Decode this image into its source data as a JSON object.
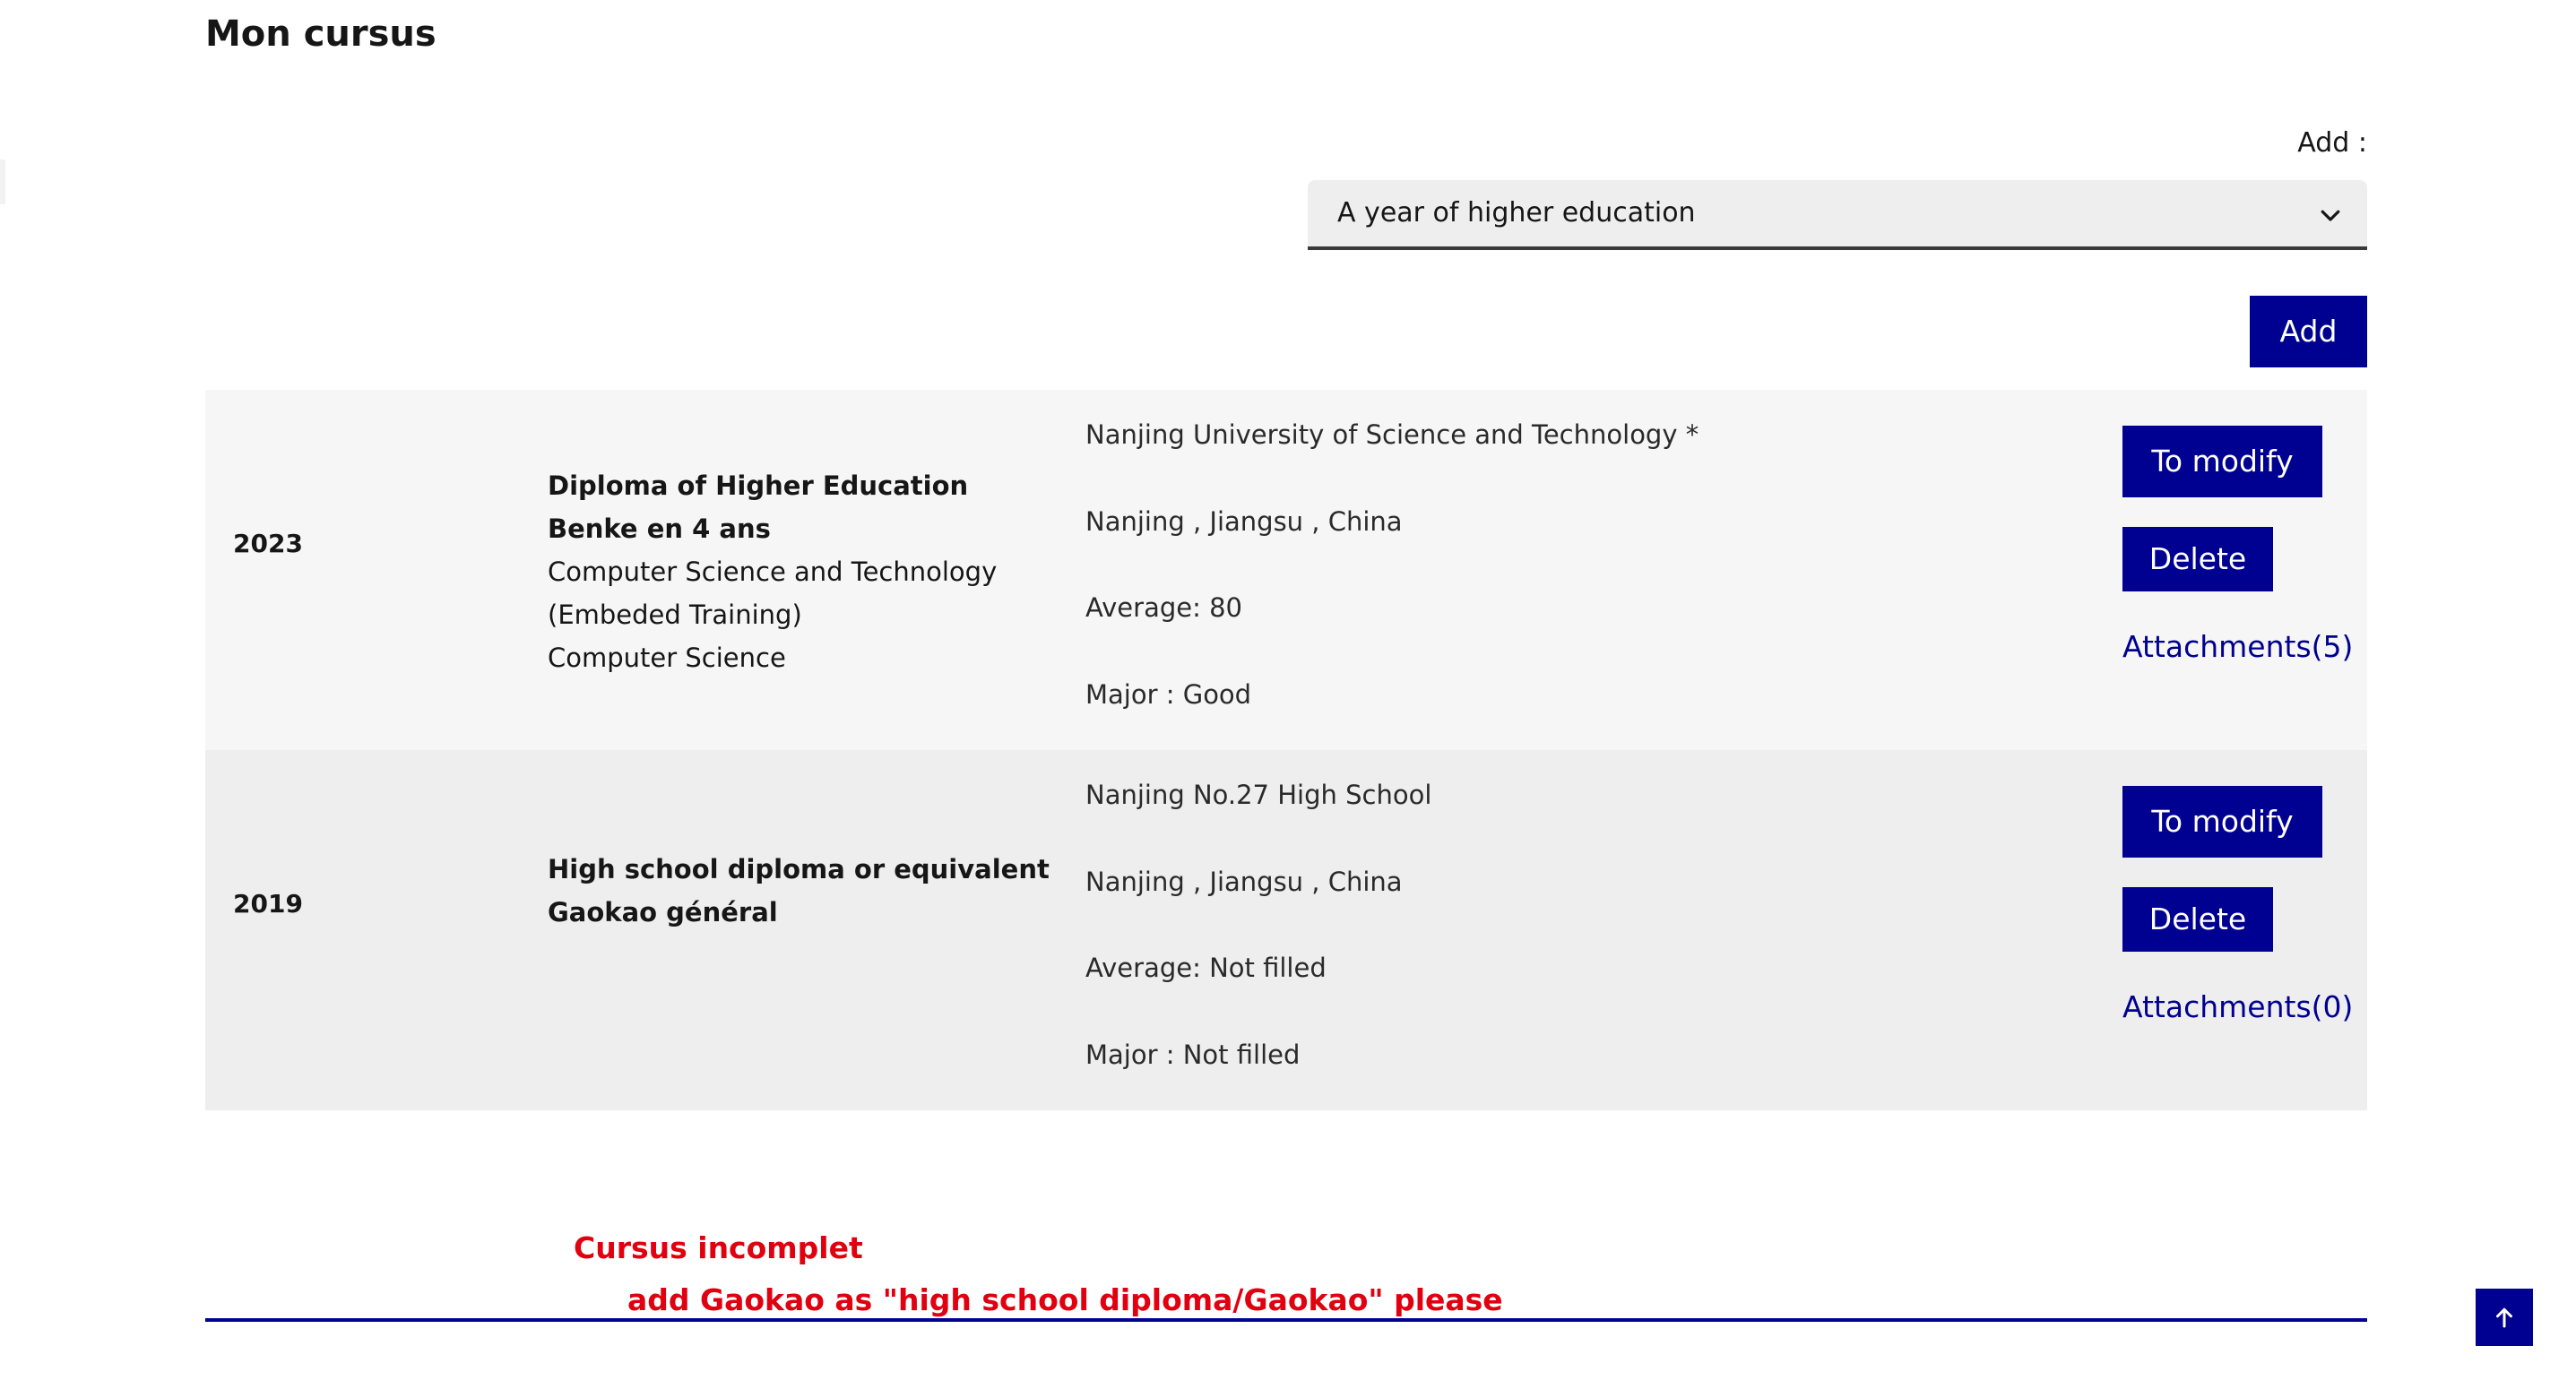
{
  "page": {
    "title": "Mon cursus"
  },
  "add_section": {
    "label": "Add :",
    "select_value": "A year of higher education",
    "add_button": "Add"
  },
  "entries": [
    {
      "year": "2023",
      "diploma_title": "Diploma of Higher Education",
      "diploma_subtitle": "Benke en 4 ans",
      "field_line_1": "Computer Science and Technology",
      "field_line_2": "(Embeded Training)",
      "field_line_3": "Computer Science",
      "institution": "Nanjing University of Science and Technology *",
      "location": "Nanjing , Jiangsu , China",
      "average": "Average: 80",
      "major": "Major : Good",
      "modify_label": "To modify",
      "delete_label": "Delete",
      "attachments_label": "Attachments(5)"
    },
    {
      "year": "2019",
      "diploma_title": "High school diploma or equivalent",
      "diploma_subtitle": "Gaokao général",
      "institution": "Nanjing No.27 High School",
      "location": "Nanjing , Jiangsu , China",
      "average": "Average: Not filled",
      "major": "Major : Not filled",
      "modify_label": "To modify",
      "delete_label": "Delete",
      "attachments_label": "Attachments(0)"
    }
  ],
  "warning": {
    "line_1": "Cursus incomplet",
    "line_2": "add Gaokao as \"high school diploma/Gaokao\" please"
  },
  "colors": {
    "primary": "#000091",
    "warning": "#e1000f",
    "row_light": "#f6f6f6",
    "row_dark": "#eeeeee"
  },
  "icons": {
    "select_chevron": "chevron-down-icon",
    "scroll_top": "arrow-up-icon"
  }
}
